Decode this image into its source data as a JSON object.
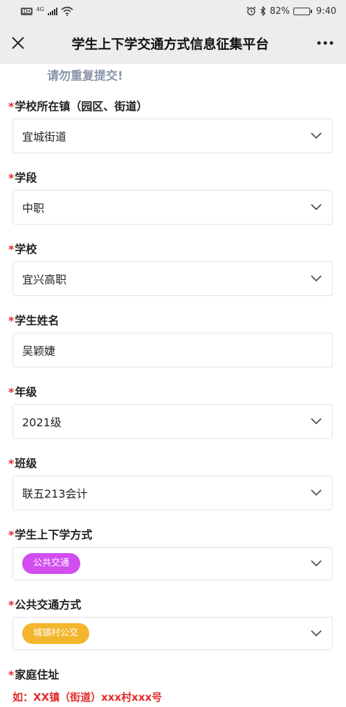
{
  "status_bar": {
    "hd": "HD",
    "network": "4G",
    "battery": "82%",
    "time": "9:40",
    "battery_level": 0.82
  },
  "nav": {
    "title": "学生上下学交通方式信息征集平台"
  },
  "notice": "请勿重复提交!",
  "fields": [
    {
      "label": "学校所在镇（园区、街道）",
      "value": "宜城街道",
      "type": "select"
    },
    {
      "label": "学段",
      "value": "中职",
      "type": "select"
    },
    {
      "label": "学校",
      "value": "宜兴高职",
      "type": "select"
    },
    {
      "label": "学生姓名",
      "value": "吴颖婕",
      "type": "text"
    },
    {
      "label": "年级",
      "value": "2021级",
      "type": "select"
    },
    {
      "label": "班级",
      "value": "联五213会计",
      "type": "select"
    },
    {
      "label": "学生上下学方式",
      "value": "公共交通",
      "type": "tag-select",
      "tag_color": "#d24ef0"
    },
    {
      "label": "公共交通方式",
      "value": "城镇村公交",
      "type": "tag-select",
      "tag_color": "#f3b62c"
    },
    {
      "label": "家庭住址",
      "hint": "如：XX镇（街道）xxx村xxx号"
    }
  ],
  "required_mark": "*",
  "colors": {
    "required": "#e02b2b",
    "notice": "#8a95a8",
    "tag_purple": "#d24ef0",
    "tag_yellow": "#f3b62c"
  }
}
